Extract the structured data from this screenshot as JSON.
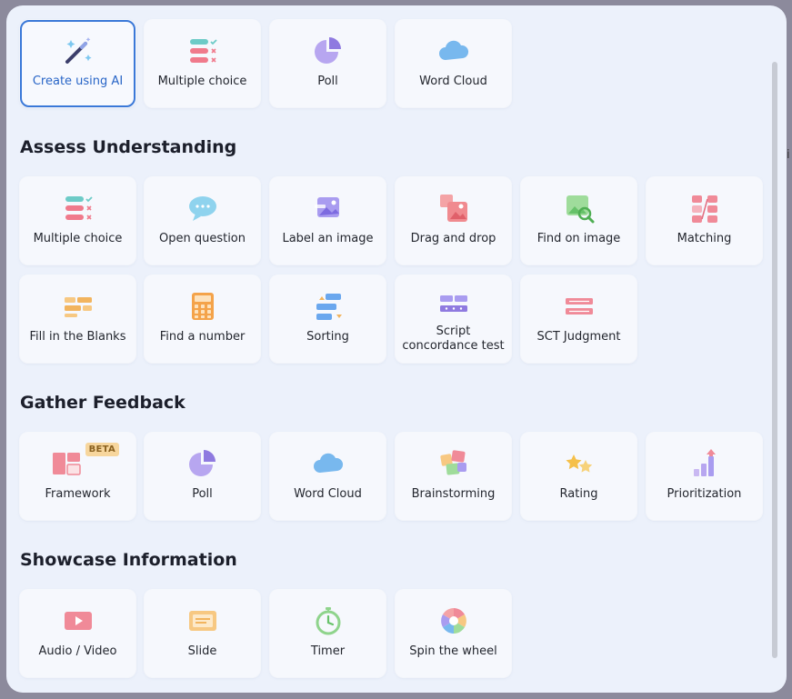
{
  "top_row": [
    {
      "label": "Create using AI",
      "icon": "magic-wand-icon"
    },
    {
      "label": "Multiple choice",
      "icon": "multiple-choice-icon"
    },
    {
      "label": "Poll",
      "icon": "pie-chart-icon"
    },
    {
      "label": "Word Cloud",
      "icon": "cloud-icon"
    }
  ],
  "sections": {
    "assess": {
      "title": "Assess Understanding",
      "items": [
        {
          "label": "Multiple choice",
          "icon": "multiple-choice-icon"
        },
        {
          "label": "Open question",
          "icon": "speech-bubble-icon"
        },
        {
          "label": "Label an image",
          "icon": "label-image-icon"
        },
        {
          "label": "Drag and drop",
          "icon": "drag-drop-icon"
        },
        {
          "label": "Find on image",
          "icon": "find-on-image-icon"
        },
        {
          "label": "Matching",
          "icon": "matching-icon"
        },
        {
          "label": "Fill in the Blanks",
          "icon": "fill-blanks-icon"
        },
        {
          "label": "Find a number",
          "icon": "calculator-icon"
        },
        {
          "label": "Sorting",
          "icon": "sorting-icon"
        },
        {
          "label": "Script concordance test",
          "icon": "script-concordance-icon"
        },
        {
          "label": "SCT Judgment",
          "icon": "sct-judgment-icon"
        }
      ]
    },
    "feedback": {
      "title": "Gather Feedback",
      "items": [
        {
          "label": "Framework",
          "icon": "framework-icon",
          "badge": "BETA"
        },
        {
          "label": "Poll",
          "icon": "pie-chart-icon"
        },
        {
          "label": "Word Cloud",
          "icon": "cloud-icon"
        },
        {
          "label": "Brainstorming",
          "icon": "brainstorming-icon"
        },
        {
          "label": "Rating",
          "icon": "star-rating-icon"
        },
        {
          "label": "Prioritization",
          "icon": "prioritization-icon"
        }
      ]
    },
    "showcase": {
      "title": "Showcase Information",
      "items": [
        {
          "label": "Audio / Video",
          "icon": "play-video-icon"
        },
        {
          "label": "Slide",
          "icon": "slide-icon"
        },
        {
          "label": "Timer",
          "icon": "stopwatch-icon"
        },
        {
          "label": "Spin the wheel",
          "icon": "spin-wheel-icon"
        }
      ]
    }
  },
  "colors": {
    "accent": "#3a78d8",
    "background": "#ecf1fb",
    "card": "#f6f8fd",
    "text": "#23262e"
  }
}
